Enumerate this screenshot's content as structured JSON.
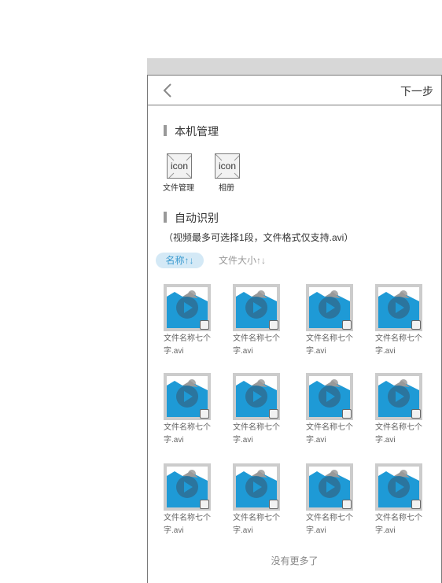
{
  "header": {
    "next_label": "下一步",
    "back_icon": "chevron-left-icon"
  },
  "local": {
    "title": "本机管理",
    "items": [
      {
        "icon_text": "icon",
        "label": "文件管理"
      },
      {
        "icon_text": "icon",
        "label": "相册"
      }
    ]
  },
  "auto": {
    "title": "自动识别",
    "note": "（视频最多可选择1段，文件格式仅支持.avi）"
  },
  "sort": {
    "by_name": "名称↑↓",
    "by_size": "文件大小↑↓",
    "active": "by_name"
  },
  "colors": {
    "accent": "#3c9bd0",
    "accent_bg": "#d4e9f6",
    "thumb_blue": "#1e9ad6"
  },
  "files": [
    {
      "name1": "文件名称七个",
      "name2": "字.avi"
    },
    {
      "name1": "文件名称七个",
      "name2": "字.avi"
    },
    {
      "name1": "文件名称七个",
      "name2": "字.avi"
    },
    {
      "name1": "文件名称七个",
      "name2": "字.avi"
    },
    {
      "name1": "文件名称七个",
      "name2": "字.avi"
    },
    {
      "name1": "文件名称七个",
      "name2": "字.avi"
    },
    {
      "name1": "文件名称七个",
      "name2": "字.avi"
    },
    {
      "name1": "文件名称七个",
      "name2": "字.avi"
    },
    {
      "name1": "文件名称七个",
      "name2": "字.avi"
    },
    {
      "name1": "文件名称七个",
      "name2": "字.avi"
    },
    {
      "name1": "文件名称七个",
      "name2": "字.avi"
    },
    {
      "name1": "文件名称七个",
      "name2": "字.avi"
    }
  ],
  "footer": {
    "no_more": "没有更多了"
  }
}
